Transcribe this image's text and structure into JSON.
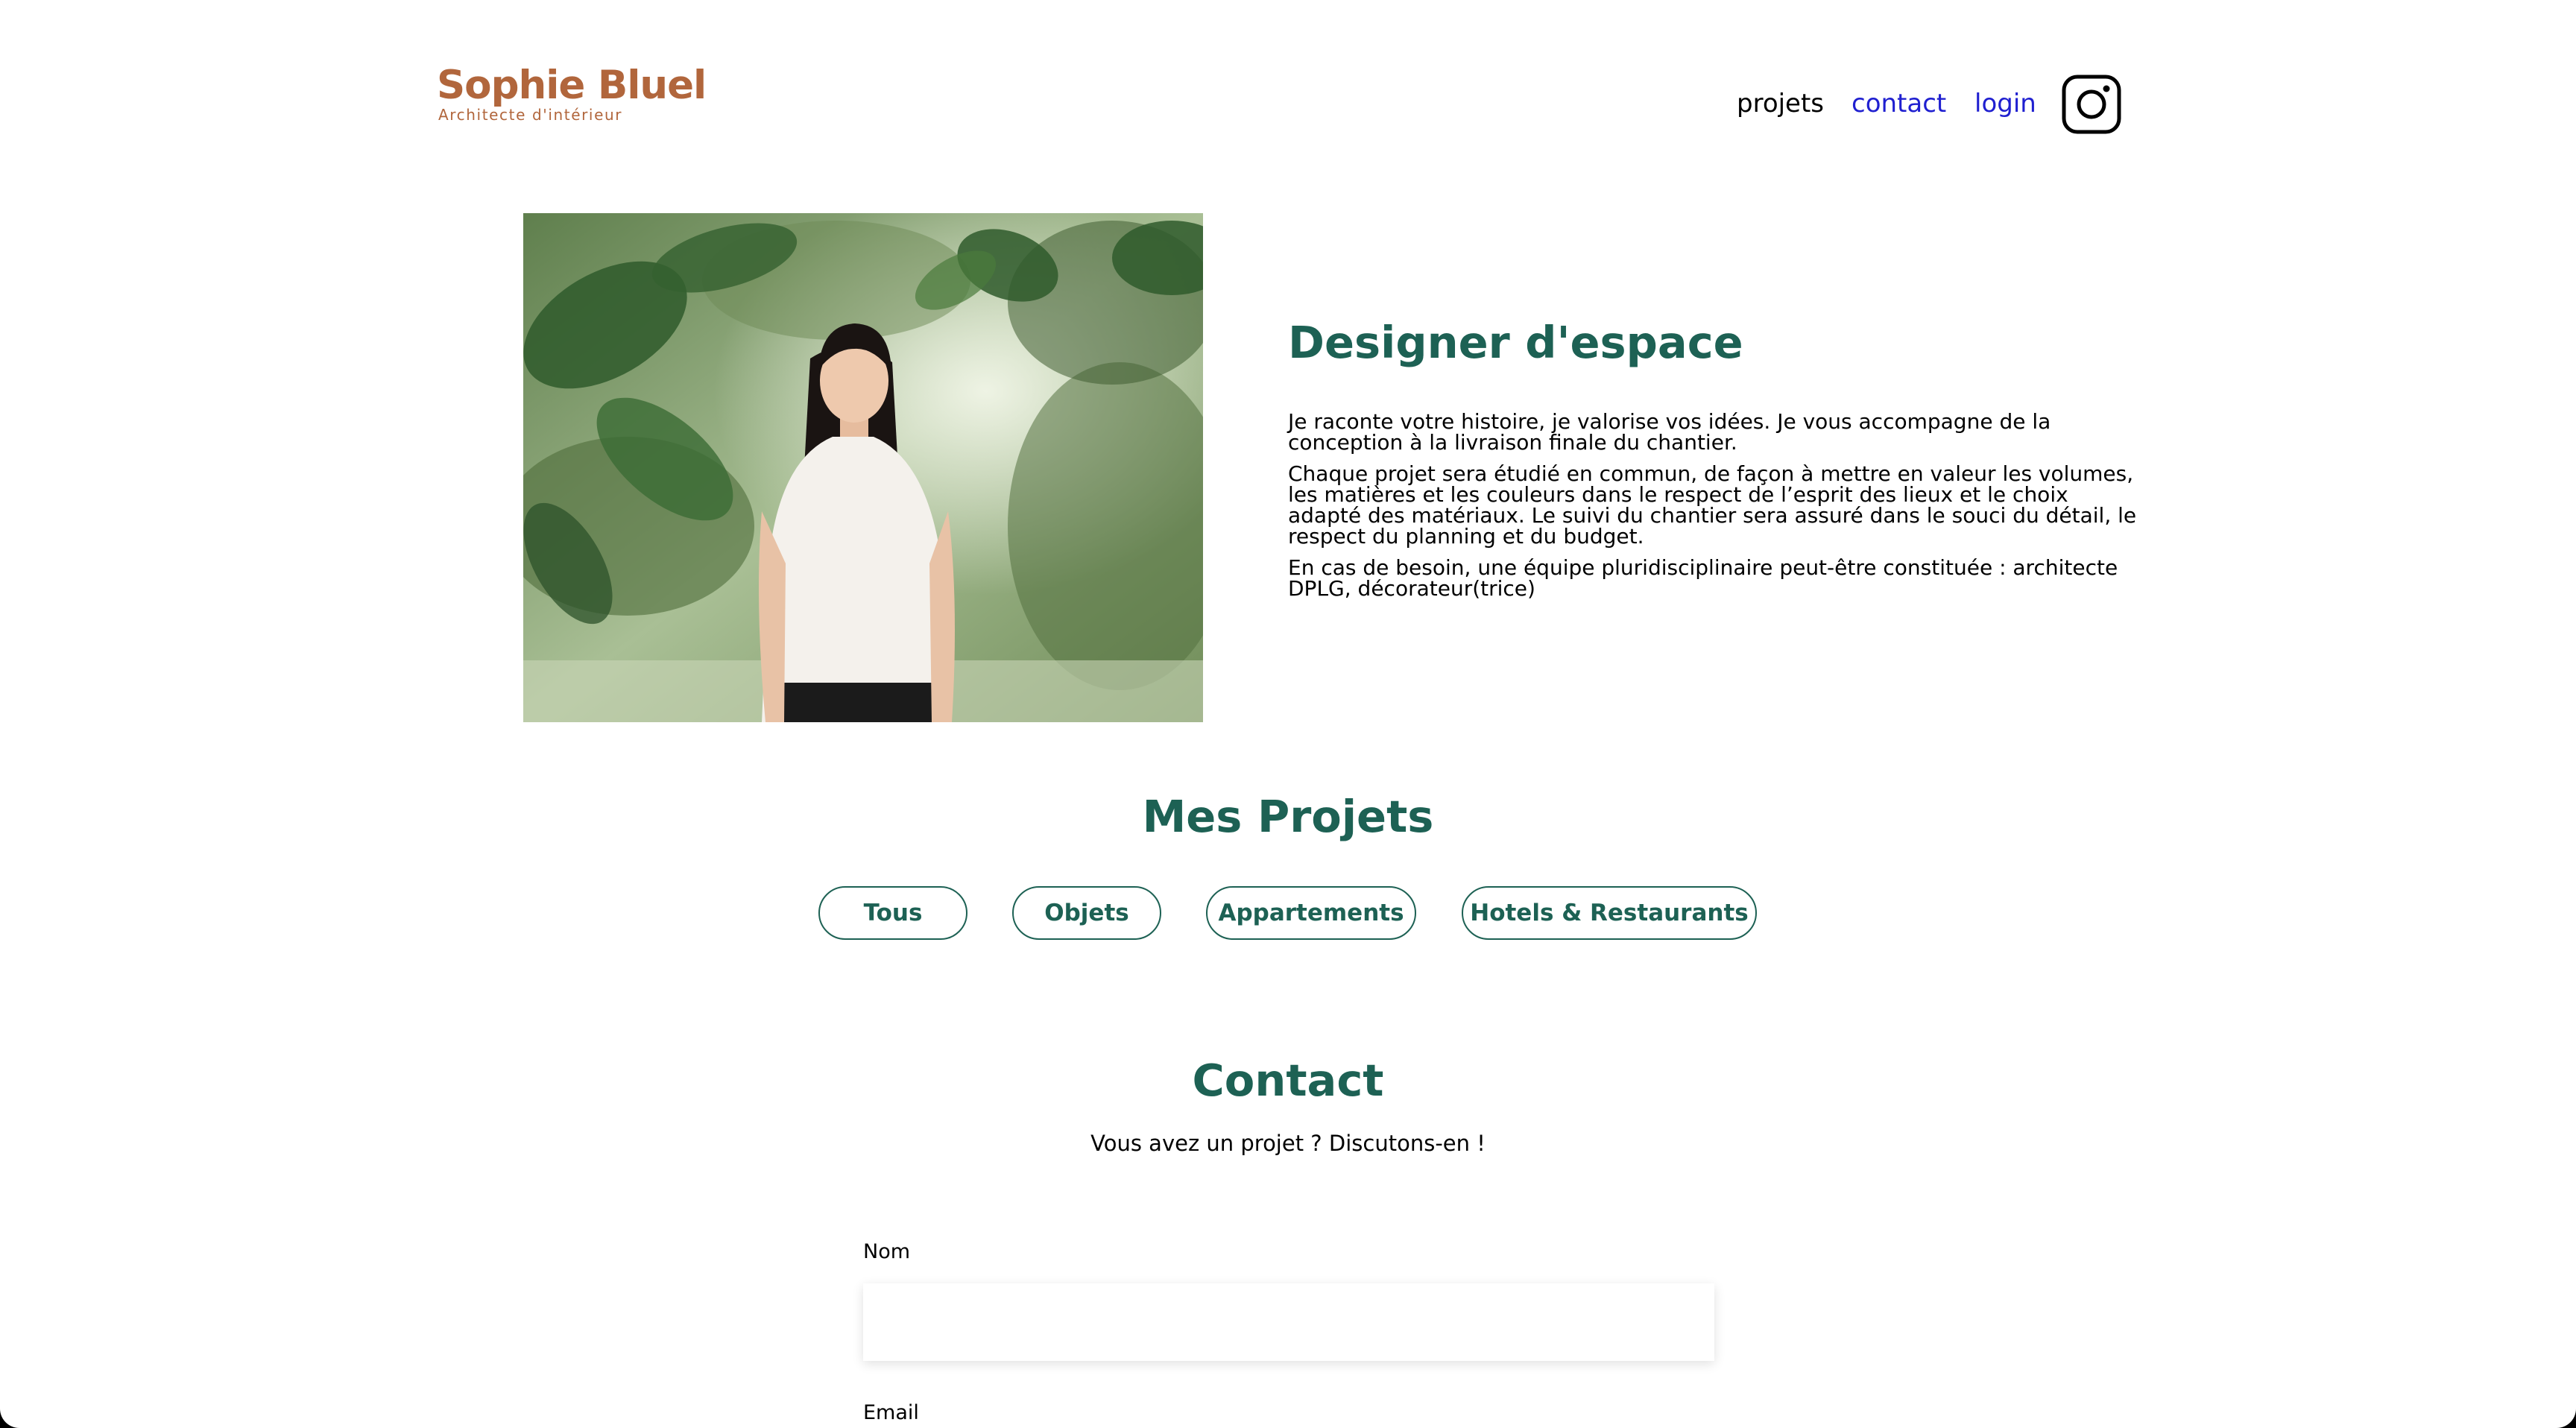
{
  "header": {
    "logo_title": "Sophie Bluel",
    "logo_subtitle": "Architecte d'intérieur",
    "nav": {
      "projets": "projets",
      "contact": "contact",
      "login": "login"
    },
    "social_icon": "instagram-icon"
  },
  "intro": {
    "title": "Designer d'espace",
    "paragraphs": [
      "Je raconte votre histoire, je valorise vos idées. Je vous accompagne de la conception à la livraison finale du chantier.",
      "Chaque projet sera étudié en commun, de façon à mettre en valeur les volumes, les matières et les couleurs dans le respect de l’esprit des lieux et le choix adapté des matériaux. Le suivi du chantier sera assuré dans le souci du détail, le respect du planning et du budget.",
      "En cas de besoin, une équipe pluridisciplinaire peut-être constituée : architecte DPLG, décorateur(trice)"
    ]
  },
  "projects": {
    "title": "Mes Projets",
    "filters": [
      "Tous",
      "Objets",
      "Appartements",
      "Hotels & Restaurants"
    ]
  },
  "contact": {
    "title": "Contact",
    "subtitle": "Vous avez un projet ? Discutons-en !",
    "fields": {
      "name_label": "Nom",
      "name_value": "",
      "email_label": "Email"
    }
  },
  "colors": {
    "brand": "#B1663C",
    "accent": "#1D6154",
    "link": "#1f1fd0"
  }
}
